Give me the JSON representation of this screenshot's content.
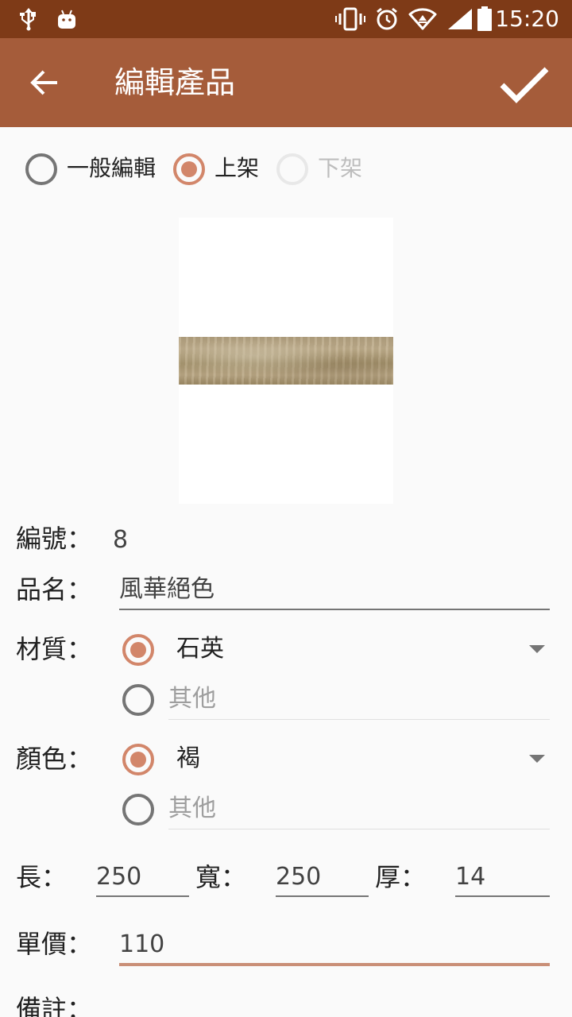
{
  "status_bar": {
    "time": "15:20",
    "icons": [
      "usb-icon",
      "android-icon",
      "vibrate-icon",
      "alarm-icon",
      "wifi-icon",
      "signal-icon",
      "battery-icon"
    ]
  },
  "app_bar": {
    "title": "編輯產品",
    "back_icon": "arrow-back-icon",
    "confirm_icon": "check-icon"
  },
  "mode": {
    "options": [
      "一般編輯",
      "上架",
      "下架"
    ],
    "selected": "上架",
    "disabled": "下架"
  },
  "form": {
    "id_label": "編號：",
    "id_value": "8",
    "name_label": "品名：",
    "name_value": "風華絕色",
    "material_label": "材質：",
    "material_value": "石英",
    "material_other": "其他",
    "color_label": "顏色：",
    "color_value": "褐",
    "color_other": "其他",
    "length_label": "長：",
    "length_value": "250",
    "width_label": "寬：",
    "width_value": "250",
    "thickness_label": "厚：",
    "thickness_value": "14",
    "price_label": "單價：",
    "price_value": "110",
    "note_label": "備註："
  },
  "colors": {
    "status_bar": "#7e3a17",
    "app_bar": "#a55c3a",
    "accent": "#d2866a",
    "active_underline": "#c98f77"
  }
}
